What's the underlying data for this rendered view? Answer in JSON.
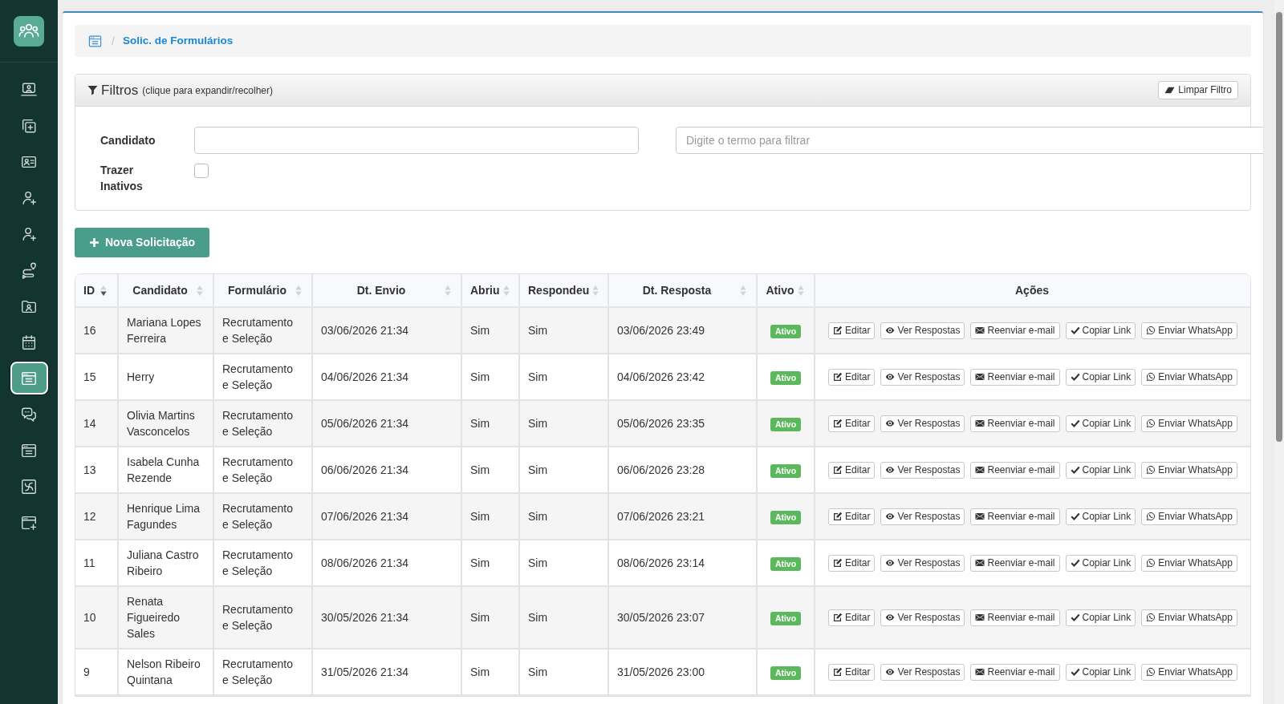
{
  "sidebar": {
    "items": [
      {
        "selected": false
      },
      {
        "selected": false
      },
      {
        "selected": false
      },
      {
        "selected": false
      },
      {
        "selected": false
      },
      {
        "selected": false
      },
      {
        "selected": false
      },
      {
        "selected": false
      },
      {
        "selected": true
      },
      {
        "selected": false
      },
      {
        "selected": false
      },
      {
        "selected": false
      },
      {
        "selected": false
      }
    ]
  },
  "breadcrumb": {
    "separator": "/",
    "current": "Solic. de Formulários"
  },
  "filters": {
    "title": "Filtros",
    "hint": "(clique para expandir/recolher)",
    "expanded": true,
    "clear_button": "Limpar Filtro",
    "candidate": {
      "label": "Candidato"
    },
    "search": {
      "placeholder": "Digite o termo para filtrar"
    },
    "inactive": {
      "label": "Trazer Inativos",
      "checked": false
    }
  },
  "new_button": "Nova Solicitação",
  "table": {
    "columns": [
      {
        "label": "ID",
        "sorted": true
      },
      {
        "label": "Candidato",
        "sorted": false
      },
      {
        "label": "Formulário",
        "sorted": false
      },
      {
        "label": "Dt. Envio",
        "sorted": false
      },
      {
        "label": "Abriu",
        "sorted": false
      },
      {
        "label": "Respondeu",
        "sorted": false
      },
      {
        "label": "Dt. Resposta",
        "sorted": false
      },
      {
        "label": "Ativo",
        "sorted": false
      },
      {
        "label": "Ações"
      }
    ],
    "rows": [
      {
        "id": "16",
        "candidate": "Mariana Lopes Ferreira",
        "form": "Recrutamento e Seleção",
        "sent": "03/06/2026 21:34",
        "opened": "Sim",
        "answered": "Sim",
        "answered_at": "03/06/2026 23:49",
        "status": "Ativo",
        "actions": [
          {
            "kind": "edit",
            "label": "Editar"
          },
          {
            "kind": "view",
            "label": "Ver Respostas"
          },
          {
            "kind": "email",
            "label": "Reenviar e-mail"
          },
          {
            "kind": "copy",
            "label": "Copiar Link"
          },
          {
            "kind": "whatsapp",
            "label": "Enviar WhatsApp"
          }
        ]
      },
      {
        "id": "15",
        "candidate": "Herry",
        "form": "Recrutamento e Seleção",
        "sent": "04/06/2026 21:34",
        "opened": "Sim",
        "answered": "Sim",
        "answered_at": "04/06/2026 23:42",
        "status": "Ativo",
        "actions": [
          {
            "kind": "edit",
            "label": "Editar"
          },
          {
            "kind": "view",
            "label": "Ver Respostas"
          },
          {
            "kind": "email",
            "label": "Reenviar e-mail"
          },
          {
            "kind": "copy",
            "label": "Copiar Link"
          },
          {
            "kind": "whatsapp",
            "label": "Enviar WhatsApp"
          }
        ]
      },
      {
        "id": "14",
        "candidate": "Olivia Martins Vasconcelos",
        "form": "Recrutamento e Seleção",
        "sent": "05/06/2026 21:34",
        "opened": "Sim",
        "answered": "Sim",
        "answered_at": "05/06/2026 23:35",
        "status": "Ativo",
        "actions": [
          {
            "kind": "edit",
            "label": "Editar"
          },
          {
            "kind": "view",
            "label": "Ver Respostas"
          },
          {
            "kind": "email",
            "label": "Reenviar e-mail"
          },
          {
            "kind": "copy",
            "label": "Copiar Link"
          },
          {
            "kind": "whatsapp",
            "label": "Enviar WhatsApp"
          }
        ]
      },
      {
        "id": "13",
        "candidate": "Isabela Cunha Rezende",
        "form": "Recrutamento e Seleção",
        "sent": "06/06/2026 21:34",
        "opened": "Sim",
        "answered": "Sim",
        "answered_at": "06/06/2026 23:28",
        "status": "Ativo",
        "actions": [
          {
            "kind": "edit",
            "label": "Editar"
          },
          {
            "kind": "view",
            "label": "Ver Respostas"
          },
          {
            "kind": "email",
            "label": "Reenviar e-mail"
          },
          {
            "kind": "copy",
            "label": "Copiar Link"
          },
          {
            "kind": "whatsapp",
            "label": "Enviar WhatsApp"
          }
        ]
      },
      {
        "id": "12",
        "candidate": "Henrique Lima Fagundes",
        "form": "Recrutamento e Seleção",
        "sent": "07/06/2026 21:34",
        "opened": "Sim",
        "answered": "Sim",
        "answered_at": "07/06/2026 23:21",
        "status": "Ativo",
        "actions": [
          {
            "kind": "edit",
            "label": "Editar"
          },
          {
            "kind": "view",
            "label": "Ver Respostas"
          },
          {
            "kind": "email",
            "label": "Reenviar e-mail"
          },
          {
            "kind": "copy",
            "label": "Copiar Link"
          },
          {
            "kind": "whatsapp",
            "label": "Enviar WhatsApp"
          }
        ]
      },
      {
        "id": "11",
        "candidate": "Juliana Castro Ribeiro",
        "form": "Recrutamento e Seleção",
        "sent": "08/06/2026 21:34",
        "opened": "Sim",
        "answered": "Sim",
        "answered_at": "08/06/2026 23:14",
        "status": "Ativo",
        "actions": [
          {
            "kind": "edit",
            "label": "Editar"
          },
          {
            "kind": "view",
            "label": "Ver Respostas"
          },
          {
            "kind": "email",
            "label": "Reenviar e-mail"
          },
          {
            "kind": "copy",
            "label": "Copiar Link"
          },
          {
            "kind": "whatsapp",
            "label": "Enviar WhatsApp"
          }
        ]
      },
      {
        "id": "10",
        "candidate": "Renata Figueiredo Sales",
        "form": "Recrutamento e Seleção",
        "sent": "30/05/2026 21:34",
        "opened": "Sim",
        "answered": "Sim",
        "answered_at": "30/05/2026 23:07",
        "status": "Ativo",
        "actions": [
          {
            "kind": "edit",
            "label": "Editar"
          },
          {
            "kind": "view",
            "label": "Ver Respostas"
          },
          {
            "kind": "email",
            "label": "Reenviar e-mail"
          },
          {
            "kind": "copy",
            "label": "Copiar Link"
          },
          {
            "kind": "whatsapp",
            "label": "Enviar WhatsApp"
          }
        ]
      },
      {
        "id": "9",
        "candidate": "Nelson Ribeiro Quintana",
        "form": "Recrutamento e Seleção",
        "sent": "31/05/2026 21:34",
        "opened": "Sim",
        "answered": "Sim",
        "answered_at": "31/05/2026 23:00",
        "status": "Ativo",
        "actions": [
          {
            "kind": "edit",
            "label": "Editar"
          },
          {
            "kind": "view",
            "label": "Ver Respostas"
          },
          {
            "kind": "email",
            "label": "Reenviar e-mail"
          },
          {
            "kind": "copy",
            "label": "Copiar Link"
          },
          {
            "kind": "whatsapp",
            "label": "Enviar WhatsApp"
          }
        ]
      }
    ]
  }
}
